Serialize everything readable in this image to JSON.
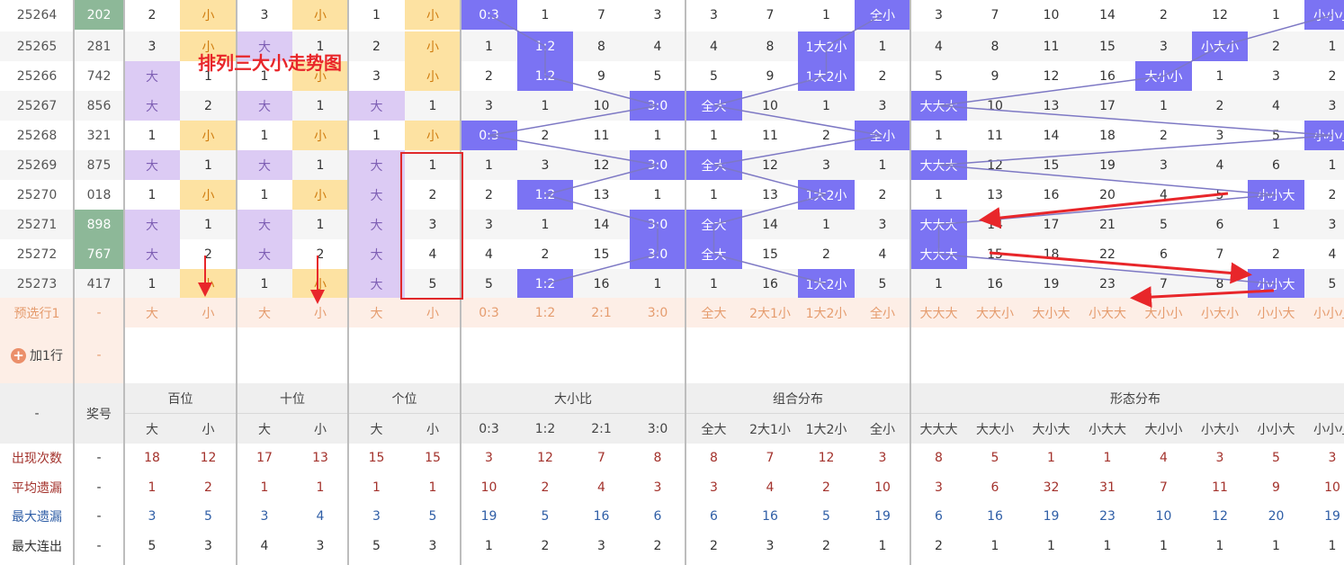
{
  "annotation_title": "排列三大小走势图",
  "add_row_label": "加1行",
  "rows": [
    {
      "issue": "25264",
      "prize": "202",
      "c": [
        "2",
        "小",
        "3",
        "小",
        "1",
        "小",
        "0:3",
        "1",
        "7",
        "3",
        "3",
        "7",
        "1",
        "全小",
        "3",
        "7",
        "10",
        "14",
        "2",
        "12",
        "1",
        "小小小"
      ]
    },
    {
      "issue": "25265",
      "prize": "281",
      "c": [
        "3",
        "小",
        "大",
        "1",
        "2",
        "小",
        "1",
        "1:2",
        "8",
        "4",
        "4",
        "8",
        "1大2小",
        "1",
        "4",
        "8",
        "11",
        "15",
        "3",
        "小大小",
        "2",
        "1"
      ]
    },
    {
      "issue": "25266",
      "prize": "742",
      "c": [
        "大",
        "1",
        "1",
        "小",
        "3",
        "小",
        "2",
        "1:2",
        "9",
        "5",
        "5",
        "9",
        "1大2小",
        "2",
        "5",
        "9",
        "12",
        "16",
        "大小小",
        "1",
        "3",
        "2"
      ]
    },
    {
      "issue": "25267",
      "prize": "856",
      "c": [
        "大",
        "2",
        "大",
        "1",
        "大",
        "1",
        "3",
        "1",
        "10",
        "3:0",
        "全大",
        "10",
        "1",
        "3",
        "大大大",
        "10",
        "13",
        "17",
        "1",
        "2",
        "4",
        "3"
      ]
    },
    {
      "issue": "25268",
      "prize": "321",
      "c": [
        "1",
        "小",
        "1",
        "小",
        "1",
        "小",
        "0:3",
        "2",
        "11",
        "1",
        "1",
        "11",
        "2",
        "全小",
        "1",
        "11",
        "14",
        "18",
        "2",
        "3",
        "5",
        "小小小"
      ]
    },
    {
      "issue": "25269",
      "prize": "875",
      "c": [
        "大",
        "1",
        "大",
        "1",
        "大",
        "1",
        "1",
        "3",
        "12",
        "3:0",
        "全大",
        "12",
        "3",
        "1",
        "大大大",
        "12",
        "15",
        "19",
        "3",
        "4",
        "6",
        "1"
      ]
    },
    {
      "issue": "25270",
      "prize": "018",
      "c": [
        "1",
        "小",
        "1",
        "小",
        "大",
        "2",
        "2",
        "1:2",
        "13",
        "1",
        "1",
        "13",
        "1大2小",
        "2",
        "1",
        "13",
        "16",
        "20",
        "4",
        "5",
        "小小大",
        "2"
      ]
    },
    {
      "issue": "25271",
      "prize": "898",
      "c": [
        "大",
        "1",
        "大",
        "1",
        "大",
        "3",
        "3",
        "1",
        "14",
        "3:0",
        "全大",
        "14",
        "1",
        "3",
        "大大大",
        "14",
        "17",
        "21",
        "5",
        "6",
        "1",
        "3"
      ]
    },
    {
      "issue": "25272",
      "prize": "767",
      "c": [
        "大",
        "2",
        "大",
        "2",
        "大",
        "4",
        "4",
        "2",
        "15",
        "3:0",
        "全大",
        "15",
        "2",
        "4",
        "大大大",
        "15",
        "18",
        "22",
        "6",
        "7",
        "2",
        "4"
      ]
    },
    {
      "issue": "25273",
      "prize": "417",
      "c": [
        "1",
        "小",
        "1",
        "小",
        "大",
        "5",
        "5",
        "1:2",
        "16",
        "1",
        "1",
        "16",
        "1大2小",
        "5",
        "1",
        "16",
        "19",
        "23",
        "7",
        "8",
        "小小大",
        "5"
      ]
    }
  ],
  "preselect": {
    "label": "预选行1",
    "prize": "-",
    "c": [
      "大",
      "小",
      "大",
      "小",
      "大",
      "小",
      "0:3",
      "1:2",
      "2:1",
      "3:0",
      "全大",
      "2大1小",
      "1大2小",
      "全小",
      "大大大",
      "大大小",
      "大小大",
      "小大大",
      "大小小",
      "小大小",
      "小小大",
      "小小小"
    ]
  },
  "add_row_dash": "-",
  "header": {
    "corner": "-",
    "prize": "奖号",
    "groups": [
      "百位",
      "十位",
      "个位",
      "大小比",
      "组合分布",
      "形态分布"
    ],
    "subs": [
      "大",
      "小",
      "大",
      "小",
      "大",
      "小",
      "0:3",
      "1:2",
      "2:1",
      "3:0",
      "全大",
      "2大1小",
      "1大2小",
      "全小",
      "大大大",
      "大大小",
      "大小大",
      "小大大",
      "大小小",
      "小大小",
      "小小大",
      "小小小"
    ]
  },
  "stats": [
    {
      "label": "出现次数",
      "prize": "-",
      "c": [
        "18",
        "12",
        "17",
        "13",
        "15",
        "15",
        "3",
        "12",
        "7",
        "8",
        "8",
        "7",
        "12",
        "3",
        "8",
        "5",
        "1",
        "1",
        "4",
        "3",
        "5",
        "3"
      ]
    },
    {
      "label": "平均遗漏",
      "prize": "-",
      "c": [
        "1",
        "2",
        "1",
        "1",
        "1",
        "1",
        "10",
        "2",
        "4",
        "3",
        "3",
        "4",
        "2",
        "10",
        "3",
        "6",
        "32",
        "31",
        "7",
        "11",
        "9",
        "10"
      ]
    },
    {
      "label": "最大遗漏",
      "prize": "-",
      "c": [
        "3",
        "5",
        "3",
        "4",
        "3",
        "5",
        "19",
        "5",
        "16",
        "6",
        "6",
        "16",
        "5",
        "19",
        "6",
        "16",
        "19",
        "23",
        "10",
        "12",
        "20",
        "19"
      ]
    },
    {
      "label": "最大连出",
      "prize": "-",
      "c": [
        "5",
        "3",
        "4",
        "3",
        "5",
        "3",
        "1",
        "2",
        "3",
        "2",
        "2",
        "3",
        "2",
        "1",
        "2",
        "1",
        "1",
        "1",
        "1",
        "1",
        "1",
        "1"
      ]
    }
  ],
  "colors": {
    "purple": "#dccbf4",
    "yellow": "#fde2a2",
    "green": "#8db898",
    "blue": "#7b73f3",
    "preselect": "#fdeee6",
    "stat_red": "#a3322c",
    "stat_blue": "#2f5ea6",
    "annotation_red": "#e8262a",
    "line": "#7d78c4"
  }
}
